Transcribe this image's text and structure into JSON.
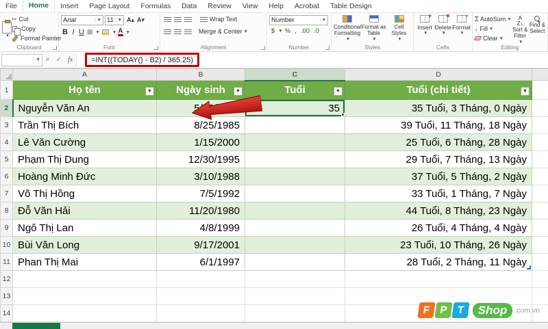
{
  "tabs": {
    "items": [
      "File",
      "Home",
      "Insert",
      "Page Layout",
      "Formulas",
      "Data",
      "Review",
      "View",
      "Help",
      "Acrobat",
      "Table Design"
    ],
    "active": "Home"
  },
  "ribbon": {
    "clipboard": {
      "label": "Clipboard",
      "paste": "Paste",
      "cut": "Cut",
      "copy": "Copy",
      "format_painter": "Format Painter"
    },
    "font": {
      "label": "Font",
      "family": "Arial",
      "size": "11",
      "bold": "B",
      "italic": "I",
      "underline": "U"
    },
    "alignment": {
      "label": "Alignment",
      "wrap_text": "Wrap Text",
      "merge_center": "Merge & Center"
    },
    "number": {
      "label": "Number",
      "format": "Number",
      "currency": "$",
      "percent": "%",
      "comma": ",",
      "dec_inc": ".00",
      "dec_dec": ".0"
    },
    "styles": {
      "label": "Styles",
      "conditional_1": "Conditional",
      "conditional_2": "Formatting",
      "table_1": "Format as",
      "table_2": "Table",
      "cellstyles_1": "Cell",
      "cellstyles_2": "Styles"
    },
    "cells": {
      "label": "Cells",
      "insert": "Insert",
      "delete": "Delete",
      "format": "Format"
    },
    "editing": {
      "label": "Editing",
      "autosum": "AutoSum",
      "fill": "Fill",
      "clear": "Clear",
      "sort_1": "Sort &",
      "sort_2": "Filter",
      "find_1": "Find &",
      "find_2": "Select"
    }
  },
  "formula_bar": {
    "name_box": "",
    "fx": "fx",
    "formula": "=INT((TODAY() - B2) / 365.25)"
  },
  "sheet": {
    "col_headers": [
      "A",
      "B",
      "C",
      "D"
    ],
    "selected_col": "C",
    "row_numbers": [
      "1",
      "2",
      "3",
      "4",
      "5",
      "6",
      "7",
      "8",
      "9",
      "10",
      "11",
      "12",
      "13",
      "14"
    ],
    "table_headers": [
      "Họ tên",
      "Ngày sinh",
      "Tuổi",
      "Tuổi (chi tiết)"
    ],
    "rows": [
      {
        "name": "Nguyễn Văn An",
        "dob": "5/12/1990",
        "age": "35",
        "detail": "35 Tuổi, 3 Tháng, 0 Ngày"
      },
      {
        "name": "Trần Thị Bích",
        "dob": "8/25/1985",
        "age": "",
        "detail": "39 Tuổi, 11 Tháng, 18 Ngày"
      },
      {
        "name": "Lê Văn Cường",
        "dob": "1/15/2000",
        "age": "",
        "detail": "25 Tuổi, 6 Tháng, 28 Ngày"
      },
      {
        "name": "Phạm Thị Dung",
        "dob": "12/30/1995",
        "age": "",
        "detail": "29 Tuổi, 7 Tháng, 13 Ngày"
      },
      {
        "name": "Hoàng Minh Đức",
        "dob": "3/10/1988",
        "age": "",
        "detail": "37 Tuổi, 5 Tháng, 2 Ngày"
      },
      {
        "name": "Võ Thị Hồng",
        "dob": "7/5/1992",
        "age": "",
        "detail": "33 Tuổi, 1 Tháng, 7 Ngày"
      },
      {
        "name": "Đỗ Văn Hải",
        "dob": "11/20/1980",
        "age": "",
        "detail": "44 Tuổi, 8 Tháng, 23 Ngày"
      },
      {
        "name": "Ngô Thị Lan",
        "dob": "4/8/1999",
        "age": "",
        "detail": "26 Tuổi, 4 Tháng, 4 Ngày"
      },
      {
        "name": "Bùi Văn Long",
        "dob": "9/17/2001",
        "age": "",
        "detail": "23 Tuổi, 10 Tháng, 26 Ngày"
      },
      {
        "name": "Phan Thị Mai",
        "dob": "6/1/1997",
        "age": "",
        "detail": "28 Tuổi, 2 Tháng, 11 Ngày"
      }
    ]
  },
  "watermark": {
    "fpt": "FPT",
    "f": "F",
    "p": "P",
    "t": "T",
    "shop": "Shop",
    "domain": ".com.vn"
  },
  "colors": {
    "header_green": "#70AD47",
    "band_green": "#E2EFDA",
    "excel_green": "#217346",
    "annotation_red": "#C00000"
  }
}
